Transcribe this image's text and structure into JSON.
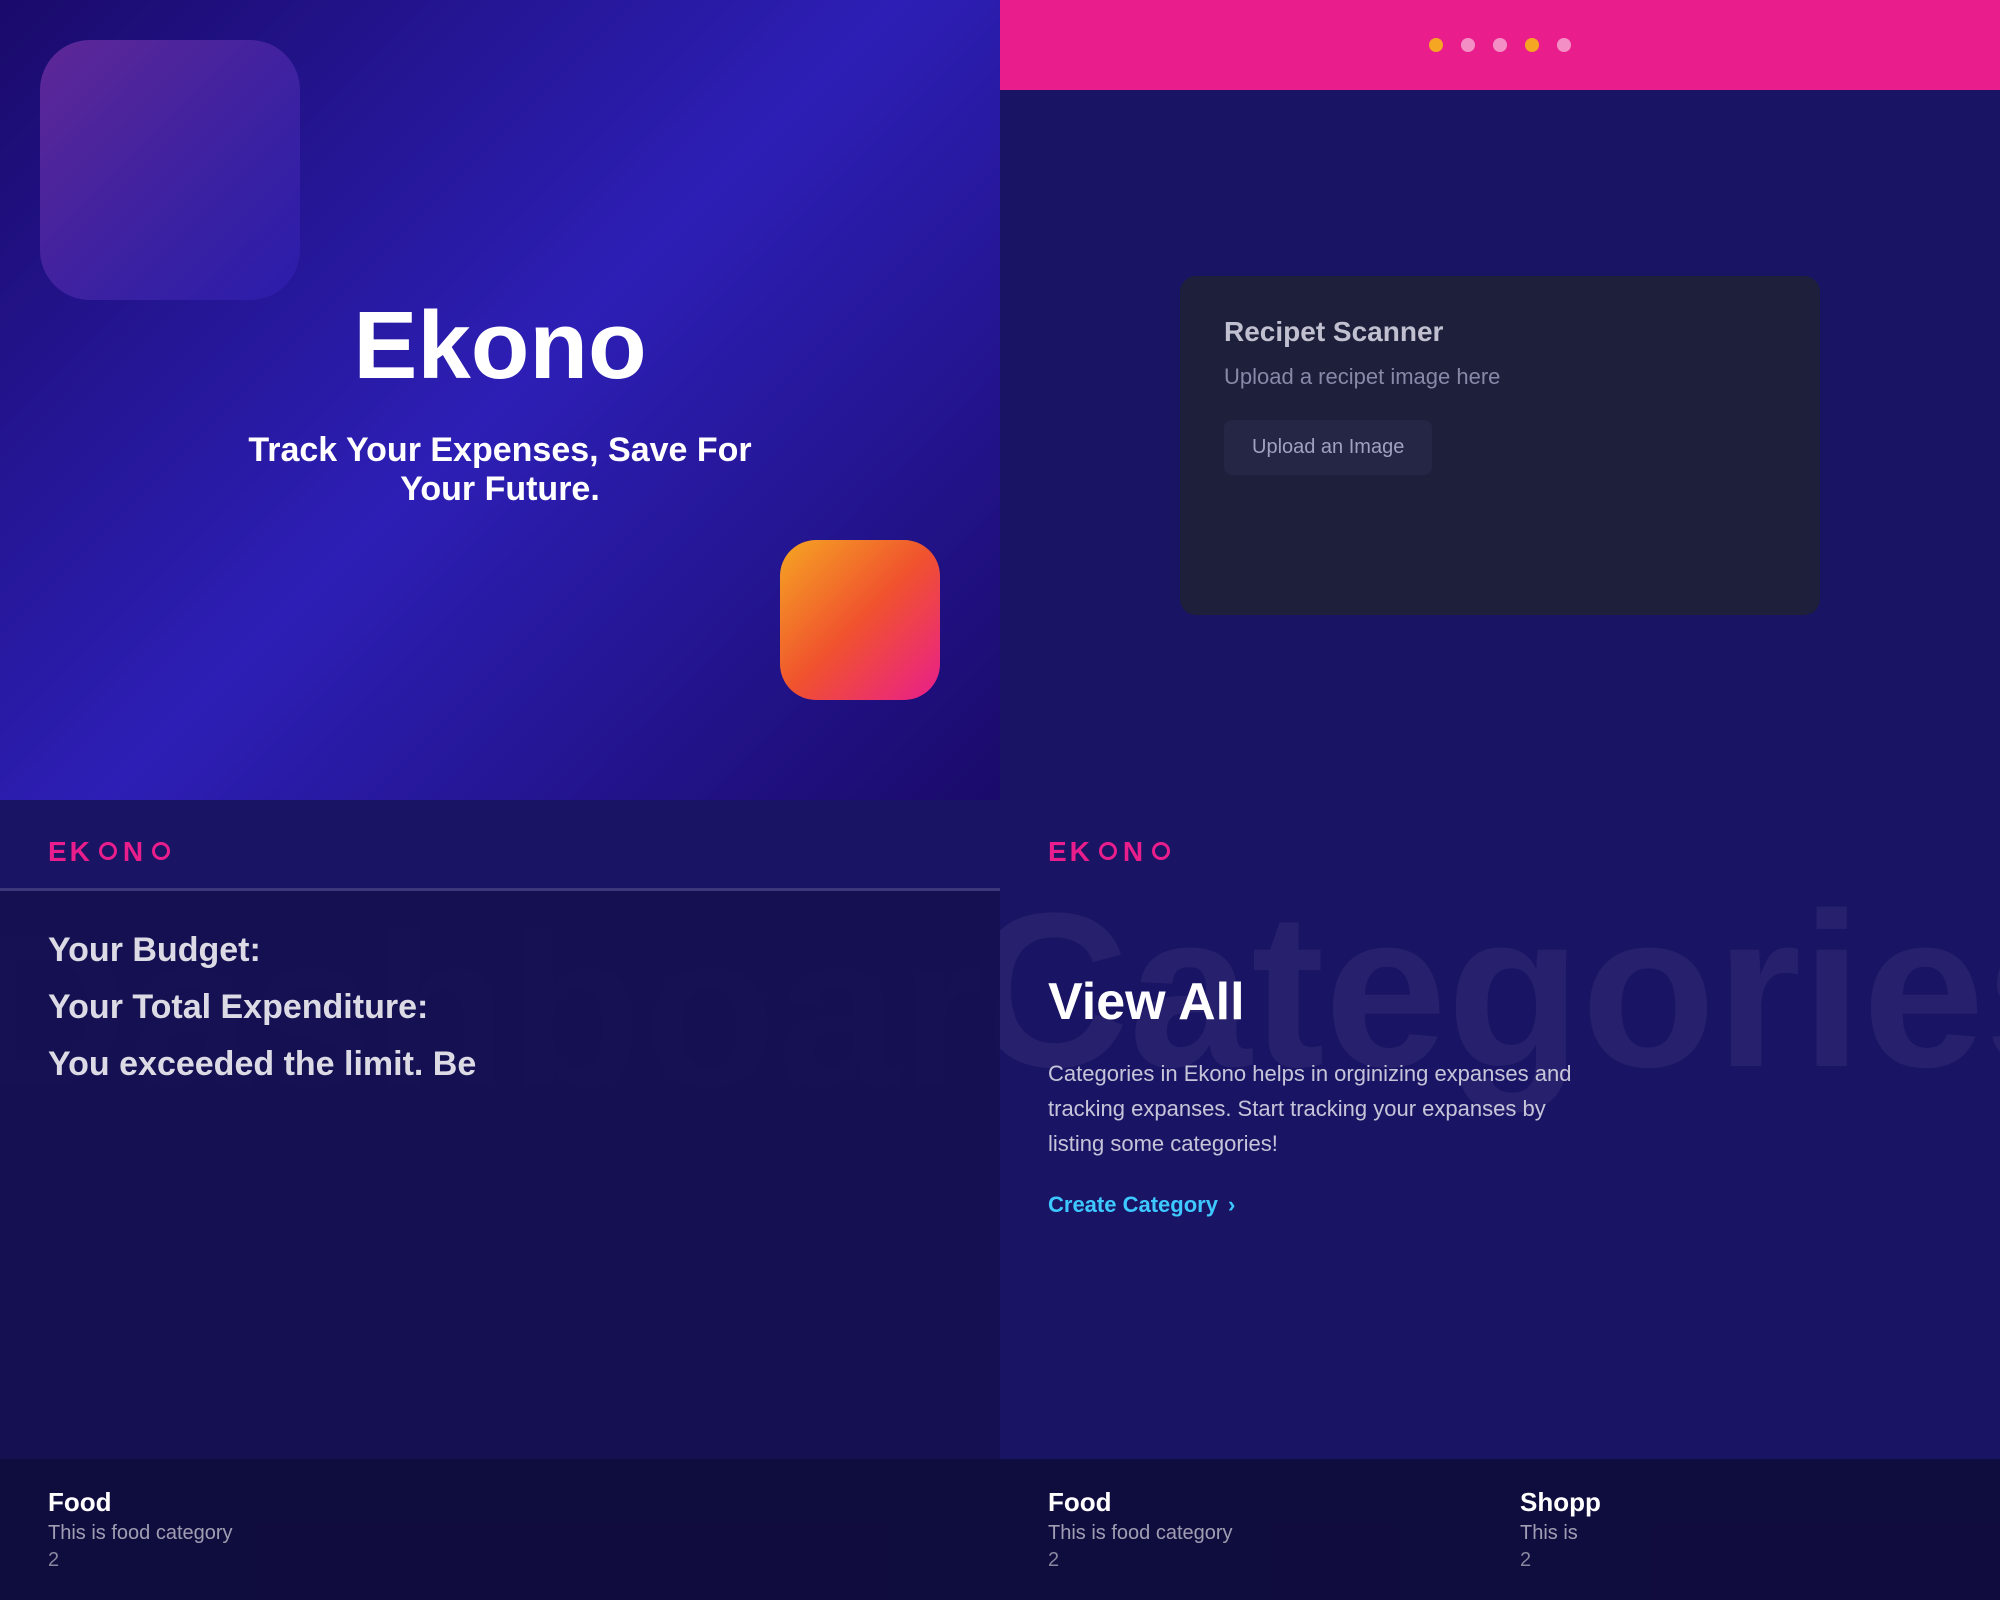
{
  "q1": {
    "app_name": "Ekono",
    "tagline": "Track Your Expenses, Save For Your Future."
  },
  "q2": {
    "dots": [
      "active",
      "inactive",
      "inactive",
      "active",
      "inactive"
    ],
    "scanner": {
      "title": "Recipet Scanner",
      "subtitle": "Upload a recipet image here",
      "upload_button": "Upload an Image"
    }
  },
  "q3": {
    "logo": "EKONO",
    "bg_title": "Dashboard",
    "budget_label": "Your Budget:",
    "expenditure_label": "Your Total Expenditure:",
    "warning_label": "You exceeded the limit. Be",
    "category": {
      "name": "Food",
      "description": "This is food category",
      "count": "2"
    }
  },
  "q4": {
    "logo": "EKONO",
    "bg_title": "Categories",
    "view_all": "View All",
    "description": "Categories in Ekono helps in orginizing expanses and tracking expanses. Start tracking your expanses by listing some categories!",
    "create_link": "Create Category",
    "category_food": {
      "name": "Food",
      "description": "This is food category",
      "count": "2"
    },
    "category_shopping": {
      "name": "Shopp",
      "description": "This is",
      "count": "2"
    }
  }
}
